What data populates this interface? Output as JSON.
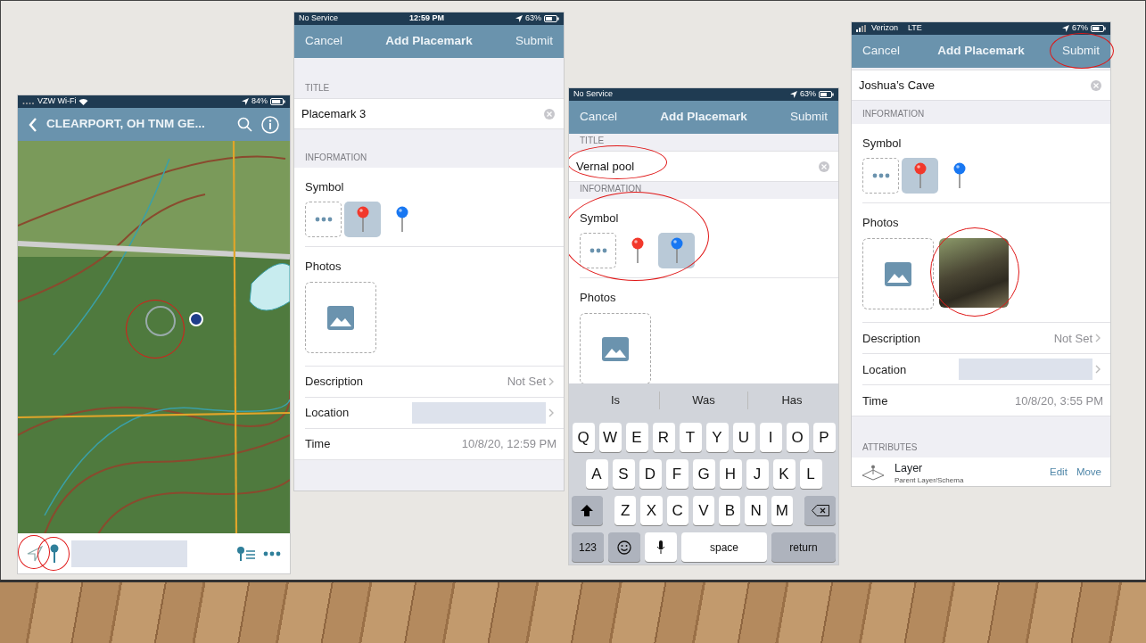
{
  "screens": [
    {
      "kind": "map",
      "status_bar": {
        "carrier": "VZW Wi-Fi",
        "battery": "84%"
      },
      "nav": {
        "title": "CLEARPORT, OH TNM GE..."
      },
      "map": {
        "target_circled": true
      },
      "toolbar": {
        "locate_circled": true,
        "pin_circled": true
      }
    },
    {
      "kind": "form",
      "status_bar": {
        "carrier": "No Service",
        "time": "12:59 PM",
        "battery": "63%"
      },
      "nav": {
        "cancel": "Cancel",
        "title": "Add Placemark",
        "submit": "Submit"
      },
      "title_section": {
        "header": "TITLE",
        "value": "Placemark 3"
      },
      "info_header": "INFORMATION",
      "symbol": {
        "label": "Symbol",
        "options": [
          {
            "kind": "more",
            "selected": false
          },
          {
            "kind": "pin",
            "color": "#f2382b",
            "selected": true
          },
          {
            "kind": "pin",
            "color": "#1877f2",
            "selected": false
          }
        ]
      },
      "photos": {
        "label": "Photos",
        "items": [
          {
            "kind": "add"
          }
        ]
      },
      "rows": [
        {
          "kind": "value",
          "label": "Description",
          "value": "Not Set",
          "chevron": true
        },
        {
          "kind": "redacted",
          "label": "Location",
          "chevron": true
        },
        {
          "kind": "value",
          "label": "Time",
          "value": "10/8/20, 12:59 PM",
          "chevron": false
        }
      ]
    },
    {
      "kind": "form",
      "status_bar": {
        "carrier": "No Service",
        "battery": "63%"
      },
      "nav": {
        "cancel": "Cancel",
        "title": "Add Placemark",
        "submit": "Submit"
      },
      "title_section": {
        "header": "TITLE",
        "value": "Vernal pool",
        "circled": true
      },
      "info_header": "INFORMATION",
      "symbol": {
        "label": "Symbol",
        "circled": true,
        "options": [
          {
            "kind": "more",
            "selected": false
          },
          {
            "kind": "pin",
            "color": "#f2382b",
            "selected": false
          },
          {
            "kind": "pin",
            "color": "#1877f2",
            "selected": true
          }
        ]
      },
      "photos": {
        "label": "Photos",
        "items": [
          {
            "kind": "add"
          }
        ]
      },
      "keyboard": {
        "suggestions": [
          "Is",
          "Was",
          "Has"
        ],
        "rows": [
          [
            "Q",
            "W",
            "E",
            "R",
            "T",
            "Y",
            "U",
            "I",
            "O",
            "P"
          ],
          [
            "A",
            "S",
            "D",
            "F",
            "G",
            "H",
            "J",
            "K",
            "L"
          ],
          [
            "Z",
            "X",
            "C",
            "V",
            "B",
            "N",
            "M"
          ]
        ],
        "numbers": "123",
        "space": "space",
        "return": "return"
      }
    },
    {
      "kind": "form",
      "status_bar": {
        "carrier": "Verizon",
        "network": "LTE",
        "battery": "67%"
      },
      "nav": {
        "cancel": "Cancel",
        "title": "Add Placemark",
        "submit": "Submit",
        "submit_circled": true
      },
      "title_section": {
        "value": "Joshua’s Cave"
      },
      "info_header": "INFORMATION",
      "symbol": {
        "label": "Symbol",
        "options": [
          {
            "kind": "more",
            "selected": false
          },
          {
            "kind": "pin",
            "color": "#f2382b",
            "selected": true
          },
          {
            "kind": "pin",
            "color": "#1877f2",
            "selected": false
          }
        ]
      },
      "photos": {
        "label": "Photos",
        "items": [
          {
            "kind": "add"
          },
          {
            "kind": "photo",
            "circled": true
          }
        ]
      },
      "rows": [
        {
          "kind": "value",
          "label": "Description",
          "value": "Not Set",
          "chevron": true
        },
        {
          "kind": "redacted",
          "label": "Location",
          "chevron": true
        },
        {
          "kind": "value",
          "label": "Time",
          "value": "10/8/20, 3:55 PM",
          "chevron": false
        }
      ],
      "attributes": {
        "header": "ATTRIBUTES",
        "layer": {
          "name": "Layer",
          "subtitle": "Parent Layer/Schema",
          "actions": [
            "Edit",
            "Move"
          ]
        }
      }
    }
  ]
}
